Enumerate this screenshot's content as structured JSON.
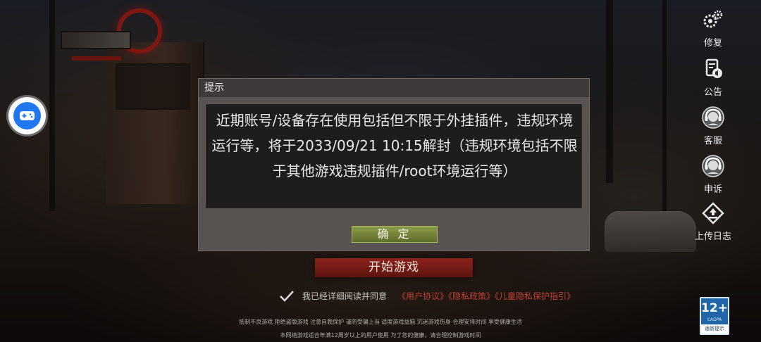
{
  "dialog": {
    "title": "提示",
    "message": "近期账号/设备存在使用包括但不限于外挂插件，违规环境运行等，将于2033/09/21 10:15解封（违规环境包括不限于其他游戏违规插件/root环境运行等）",
    "confirm_label": "确 定"
  },
  "main": {
    "start_label": "开始游戏"
  },
  "agreement": {
    "checked": true,
    "text": "我已经详细阅读并同意",
    "links": [
      "《用户协议》",
      "《隐私政策》",
      "《儿童隐私保护指引》"
    ]
  },
  "sidebar": {
    "items": [
      {
        "label": "修复",
        "icon": "gear-icon"
      },
      {
        "label": "公告",
        "icon": "announcement-icon"
      },
      {
        "label": "客服",
        "icon": "customer-service-icon"
      },
      {
        "label": "申诉",
        "icon": "appeal-icon"
      },
      {
        "label": "上传日志",
        "icon": "upload-icon"
      }
    ]
  },
  "footer": {
    "health_line1": "抵制不良游戏 拒绝盗版游戏 注意自我保护 谨防受骗上当 适度游戏益脑 沉迷游戏伤身 合理安排时间 享受健康生活",
    "health_line2": "本网络游戏适合年满12周岁以上的用户使用   为了您的健康，请合理控制游戏时间"
  },
  "age_rating": {
    "age": "12+",
    "org": "CADPA",
    "tag": "适龄提示"
  },
  "colors": {
    "dialog_bg": "#585250",
    "confirm_button": "#7a8a3c",
    "start_button": "#7a1c16",
    "link": "#c0402f",
    "float_button": "#1f78f0"
  }
}
